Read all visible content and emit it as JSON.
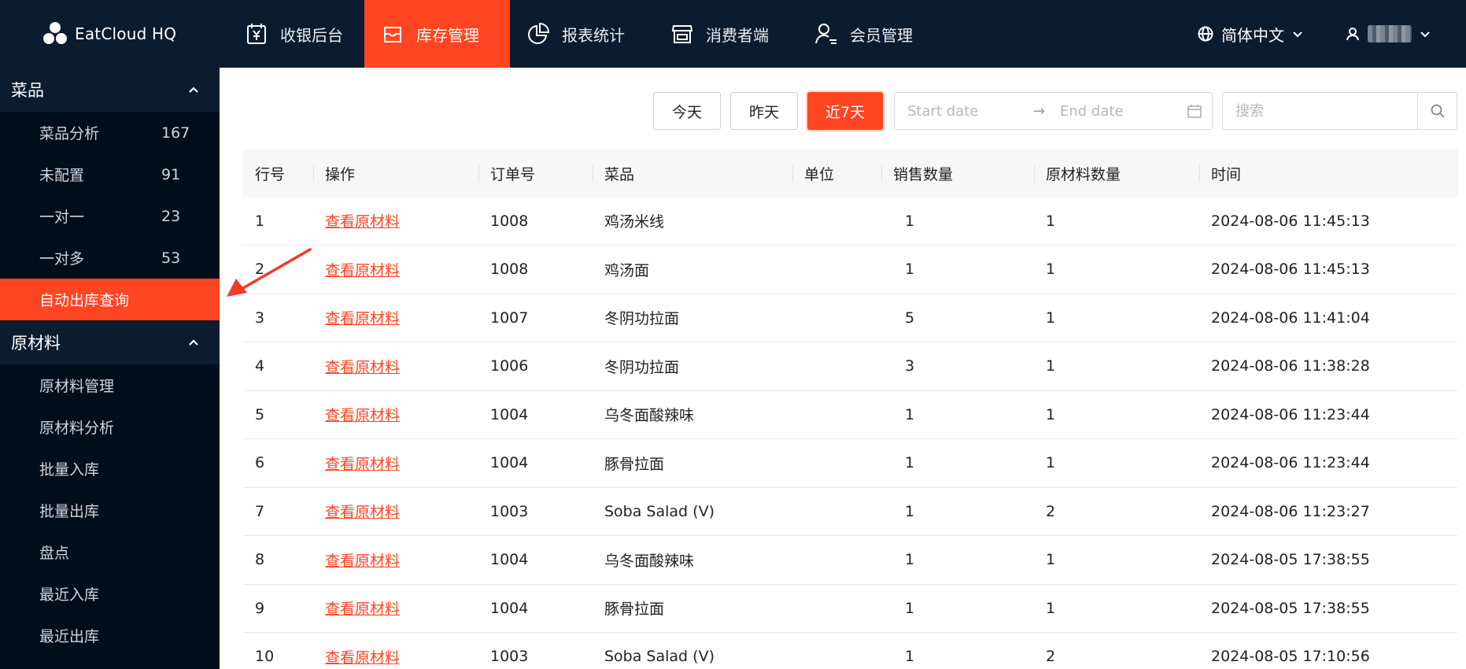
{
  "app": {
    "logo_text": "EatCloud HQ"
  },
  "nav": {
    "items": [
      {
        "label": "收银后台",
        "icon": "cashier-icon"
      },
      {
        "label": "库存管理",
        "icon": "inventory-icon",
        "active": true
      },
      {
        "label": "报表统计",
        "icon": "pie-chart-icon"
      },
      {
        "label": "消费者端",
        "icon": "store-icon"
      },
      {
        "label": "会员管理",
        "icon": "member-icon"
      }
    ]
  },
  "header": {
    "language": "简体中文"
  },
  "sidebar": {
    "groups": [
      {
        "title": "菜品",
        "items": [
          {
            "label": "菜品分析",
            "count": "167"
          },
          {
            "label": "未配置",
            "count": "91"
          },
          {
            "label": "一对一",
            "count": "23"
          },
          {
            "label": "一对多",
            "count": "53"
          },
          {
            "label": "自动出库查询",
            "count": "",
            "active": true
          }
        ]
      },
      {
        "title": "原材料",
        "items": [
          {
            "label": "原材料管理"
          },
          {
            "label": "原材料分析"
          },
          {
            "label": "批量入库"
          },
          {
            "label": "批量出库"
          },
          {
            "label": "盘点"
          },
          {
            "label": "最近入库"
          },
          {
            "label": "最近出库"
          }
        ]
      }
    ]
  },
  "filters": {
    "today": "今天",
    "yesterday": "昨天",
    "last7": "近7天",
    "start_placeholder": "Start date",
    "end_placeholder": "End date",
    "search_placeholder": "搜索"
  },
  "table": {
    "columns": [
      "行号",
      "操作",
      "订单号",
      "菜品",
      "单位",
      "销售数量",
      "原材料数量",
      "时间"
    ],
    "rows": [
      {
        "no": "1",
        "action": "查看原材料",
        "order": "1008",
        "dish": "鸡汤米线",
        "unit": "",
        "sales": "1",
        "material": "1",
        "time": "2024-08-06 11:45:13"
      },
      {
        "no": "2",
        "action": "查看原材料",
        "order": "1008",
        "dish": "鸡汤面",
        "unit": "",
        "sales": "1",
        "material": "1",
        "time": "2024-08-06 11:45:13"
      },
      {
        "no": "3",
        "action": "查看原材料",
        "order": "1007",
        "dish": "冬阴功拉面",
        "unit": "",
        "sales": "5",
        "material": "1",
        "time": "2024-08-06 11:41:04"
      },
      {
        "no": "4",
        "action": "查看原材料",
        "order": "1006",
        "dish": "冬阴功拉面",
        "unit": "",
        "sales": "3",
        "material": "1",
        "time": "2024-08-06 11:38:28"
      },
      {
        "no": "5",
        "action": "查看原材料",
        "order": "1004",
        "dish": "乌冬面酸辣味",
        "unit": "",
        "sales": "1",
        "material": "1",
        "time": "2024-08-06 11:23:44"
      },
      {
        "no": "6",
        "action": "查看原材料",
        "order": "1004",
        "dish": "豚骨拉面",
        "unit": "",
        "sales": "1",
        "material": "1",
        "time": "2024-08-06 11:23:44"
      },
      {
        "no": "7",
        "action": "查看原材料",
        "order": "1003",
        "dish": "Soba Salad (V)",
        "unit": "",
        "sales": "1",
        "material": "2",
        "time": "2024-08-06 11:23:27"
      },
      {
        "no": "8",
        "action": "查看原材料",
        "order": "1004",
        "dish": "乌冬面酸辣味",
        "unit": "",
        "sales": "1",
        "material": "1",
        "time": "2024-08-05 17:38:55"
      },
      {
        "no": "9",
        "action": "查看原材料",
        "order": "1004",
        "dish": "豚骨拉面",
        "unit": "",
        "sales": "1",
        "material": "1",
        "time": "2024-08-05 17:38:55"
      },
      {
        "no": "10",
        "action": "查看原材料",
        "order": "1003",
        "dish": "Soba Salad (V)",
        "unit": "",
        "sales": "1",
        "material": "2",
        "time": "2024-08-05 17:10:56"
      }
    ]
  },
  "colors": {
    "header_bg": "#0b1c2e",
    "sidebar_bg": "#000d1a",
    "accent": "#ff4522"
  }
}
